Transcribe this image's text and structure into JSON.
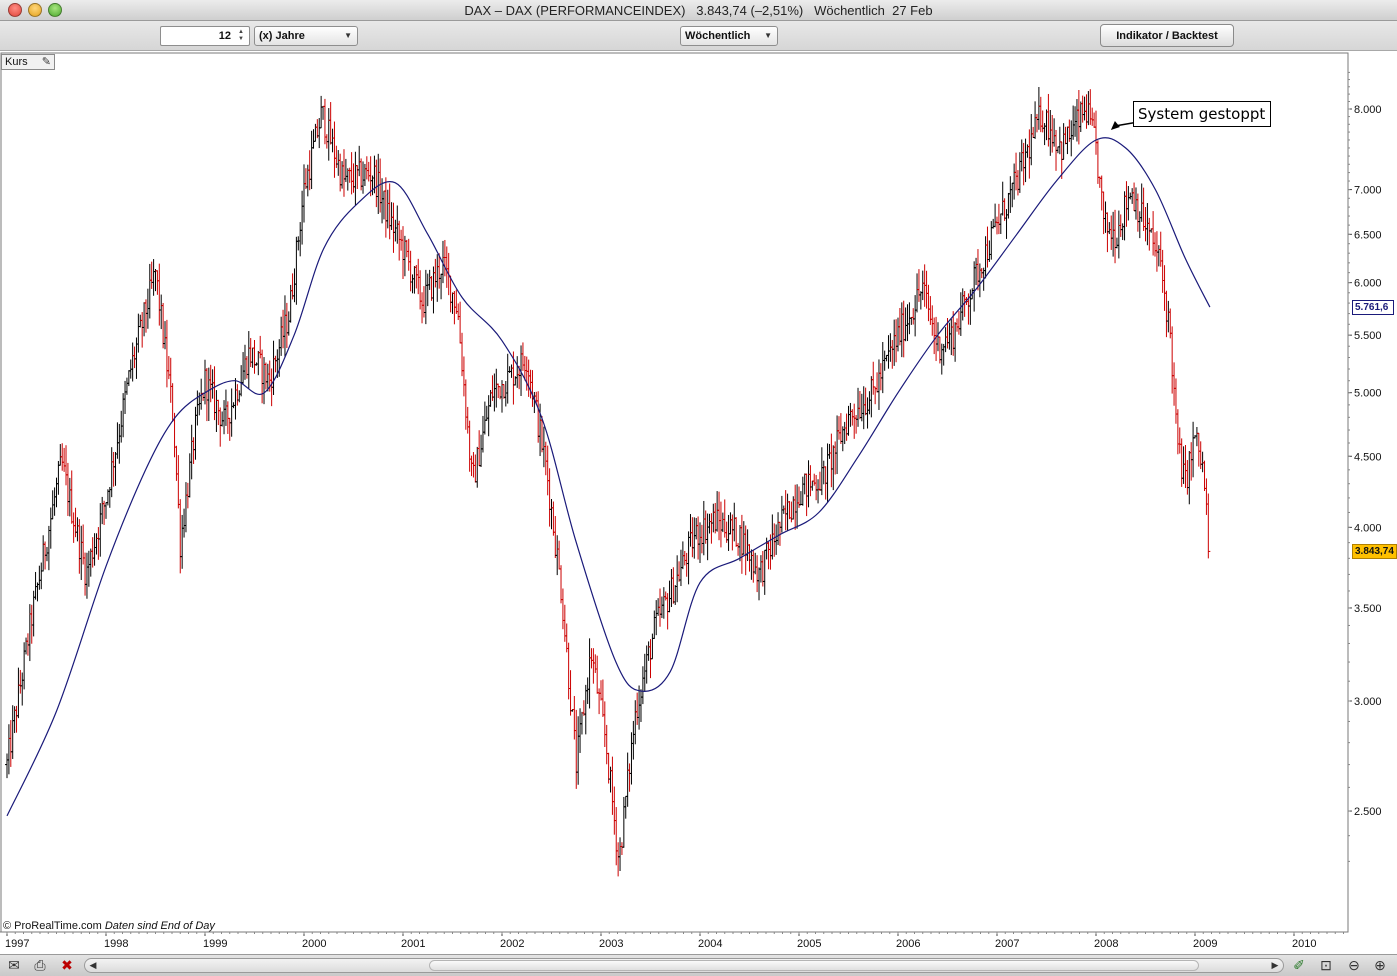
{
  "window": {
    "title": "DAX – DAX (PERFORMANCEINDEX)   3.843,74 (–2,51%)   Wöchentlich  27 Feb"
  },
  "toolbar": {
    "period_value": "12",
    "period_unit": "(x) Jahre",
    "interval": "Wöchentlich",
    "indicator_button": "Indikator / Backtest"
  },
  "panel": {
    "label": "Kurs"
  },
  "annotation": {
    "text": "System gestoppt"
  },
  "credit": {
    "source": "© ProRealTime.com",
    "note": "Daten sind End of Day"
  },
  "price_tags": {
    "moving_average": "5.761,6",
    "last": "3.843,74"
  },
  "colors": {
    "up": "#000000",
    "down": "#cc0000",
    "moving_average": "#1a1a7a",
    "last_tag": "#ffc000"
  },
  "icons": [
    "mail-icon",
    "print-icon",
    "close-chart-icon",
    "scroll-left-icon",
    "scroll-right-icon",
    "drawing-tool-icon",
    "zoom-fit-icon",
    "zoom-out-icon",
    "zoom-in-icon",
    "wrench-icon"
  ],
  "chart_data": {
    "type": "ohlc-bar",
    "title": "DAX (PERFORMANCEINDEX)",
    "interval": "weekly",
    "y_scale": "log",
    "ylim": [
      2200,
      8600
    ],
    "xlim": [
      1997.0,
      2010.5
    ],
    "grid": false,
    "y_ticks": [
      {
        "value": 8000,
        "label": "8.000"
      },
      {
        "value": 7000,
        "label": "7.000"
      },
      {
        "value": 6500,
        "label": "6.500"
      },
      {
        "value": 6000,
        "label": "6.000"
      },
      {
        "value": 5500,
        "label": "5.500"
      },
      {
        "value": 5000,
        "label": "5.000"
      },
      {
        "value": 4500,
        "label": "4.500"
      },
      {
        "value": 4000,
        "label": "4.000"
      },
      {
        "value": 3500,
        "label": "3.500"
      },
      {
        "value": 3000,
        "label": "3.000"
      },
      {
        "value": 2500,
        "label": "2.500"
      }
    ],
    "x_ticks": [
      {
        "value": 1997,
        "label": "1997"
      },
      {
        "value": 1998,
        "label": "1998"
      },
      {
        "value": 1999,
        "label": "1999"
      },
      {
        "value": 2000,
        "label": "2000"
      },
      {
        "value": 2001,
        "label": "2001"
      },
      {
        "value": 2002,
        "label": "2002"
      },
      {
        "value": 2003,
        "label": "2003"
      },
      {
        "value": 2004,
        "label": "2004"
      },
      {
        "value": 2005,
        "label": "2005"
      },
      {
        "value": 2006,
        "label": "2006"
      },
      {
        "value": 2007,
        "label": "2007"
      },
      {
        "value": 2008,
        "label": "2008"
      },
      {
        "value": 2009,
        "label": "2009"
      },
      {
        "value": 2010,
        "label": "2010"
      }
    ],
    "price_path": [
      [
        1997.0,
        2700
      ],
      [
        1997.25,
        3450
      ],
      [
        1997.55,
        4450
      ],
      [
        1997.8,
        3700
      ],
      [
        1998.0,
        4200
      ],
      [
        1998.25,
        5200
      ],
      [
        1998.5,
        6100
      ],
      [
        1998.68,
        4800
      ],
      [
        1998.75,
        3900
      ],
      [
        1998.9,
        4700
      ],
      [
        1999.0,
        5100
      ],
      [
        1999.2,
        4750
      ],
      [
        1999.45,
        5350
      ],
      [
        1999.65,
        5100
      ],
      [
        1999.85,
        5700
      ],
      [
        2000.0,
        7000
      ],
      [
        2000.18,
        7950
      ],
      [
        2000.4,
        7100
      ],
      [
        2000.7,
        7200
      ],
      [
        2000.85,
        6700
      ],
      [
        2001.0,
        6350
      ],
      [
        2001.2,
        5800
      ],
      [
        2001.4,
        6200
      ],
      [
        2001.55,
        5750
      ],
      [
        2001.7,
        4300
      ],
      [
        2001.9,
        5000
      ],
      [
        2002.1,
        5150
      ],
      [
        2002.25,
        5300
      ],
      [
        2002.45,
        4400
      ],
      [
        2002.6,
        3600
      ],
      [
        2002.75,
        2700
      ],
      [
        2002.9,
        3250
      ],
      [
        2003.05,
        2800
      ],
      [
        2003.18,
        2300
      ],
      [
        2003.35,
        2950
      ],
      [
        2003.55,
        3400
      ],
      [
        2003.75,
        3650
      ],
      [
        2003.95,
        3950
      ],
      [
        2004.15,
        4050
      ],
      [
        2004.4,
        3950
      ],
      [
        2004.6,
        3700
      ],
      [
        2004.8,
        4000
      ],
      [
        2005.0,
        4250
      ],
      [
        2005.25,
        4350
      ],
      [
        2005.5,
        4800
      ],
      [
        2005.75,
        5000
      ],
      [
        2005.95,
        5400
      ],
      [
        2006.25,
        5950
      ],
      [
        2006.4,
        5400
      ],
      [
        2006.55,
        5500
      ],
      [
        2006.8,
        6100
      ],
      [
        2007.0,
        6600
      ],
      [
        2007.2,
        7100
      ],
      [
        2007.45,
        7950
      ],
      [
        2007.65,
        7500
      ],
      [
        2007.9,
        8000
      ],
      [
        2008.0,
        7500
      ],
      [
        2008.08,
        6600
      ],
      [
        2008.2,
        6500
      ],
      [
        2008.35,
        7000
      ],
      [
        2008.5,
        6600
      ],
      [
        2008.65,
        6200
      ],
      [
        2008.75,
        5500
      ],
      [
        2008.82,
        4600
      ],
      [
        2008.9,
        4300
      ],
      [
        2009.0,
        4650
      ],
      [
        2009.08,
        4400
      ],
      [
        2009.15,
        3843.74
      ]
    ],
    "moving_average": [
      [
        1997.0,
        2480
      ],
      [
        1997.5,
        2950
      ],
      [
        1998.0,
        3750
      ],
      [
        1998.4,
        4400
      ],
      [
        1998.7,
        4800
      ],
      [
        1999.0,
        5000
      ],
      [
        1999.3,
        5100
      ],
      [
        1999.6,
        5000
      ],
      [
        1999.9,
        5500
      ],
      [
        2000.2,
        6350
      ],
      [
        2000.55,
        6850
      ],
      [
        2000.92,
        7080
      ],
      [
        2001.25,
        6500
      ],
      [
        2001.6,
        5850
      ],
      [
        2002.0,
        5450
      ],
      [
        2002.4,
        4800
      ],
      [
        2002.75,
        3900
      ],
      [
        2003.15,
        3200
      ],
      [
        2003.4,
        3050
      ],
      [
        2003.7,
        3150
      ],
      [
        2004.0,
        3650
      ],
      [
        2004.4,
        3800
      ],
      [
        2004.8,
        3950
      ],
      [
        2005.2,
        4100
      ],
      [
        2005.6,
        4500
      ],
      [
        2006.0,
        5000
      ],
      [
        2006.4,
        5500
      ],
      [
        2006.8,
        5950
      ],
      [
        2007.2,
        6500
      ],
      [
        2007.6,
        7100
      ],
      [
        2008.0,
        7600
      ],
      [
        2008.3,
        7500
      ],
      [
        2008.6,
        7000
      ],
      [
        2008.9,
        6250
      ],
      [
        2009.15,
        5761.6
      ]
    ],
    "annotation": {
      "text": "System gestoppt",
      "x": 2008.15,
      "y": 7600
    }
  }
}
